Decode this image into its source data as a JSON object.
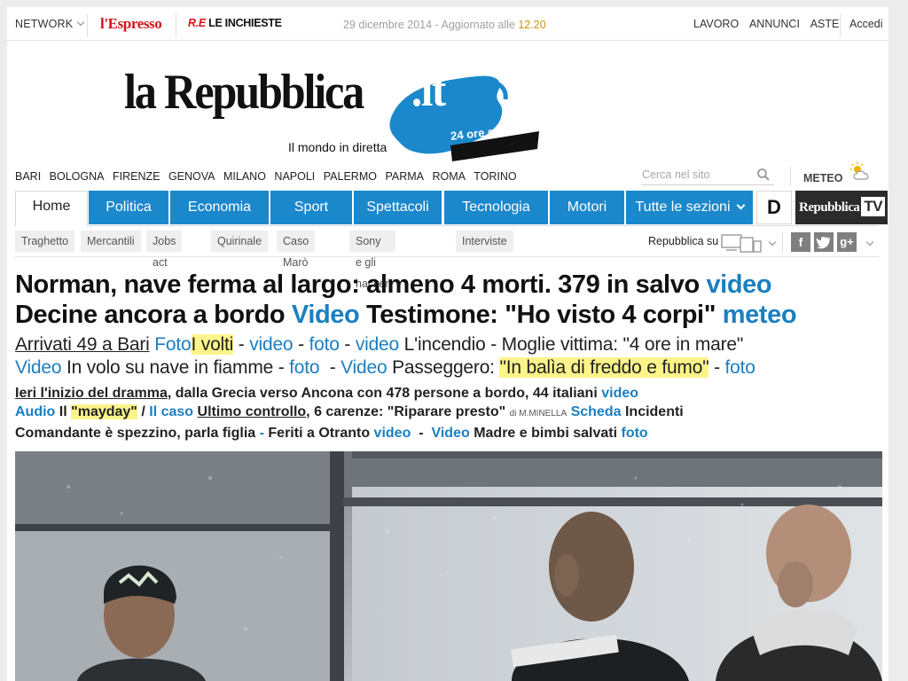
{
  "topbar": {
    "network": "NETWORK",
    "espresso": "l'Espresso",
    "inchieste_re": "R.E",
    "inchieste": "LE INCHIESTE",
    "date": "29 dicembre 2014 - Aggiornato alle ",
    "time": "12.20",
    "links": [
      "LAVORO",
      "ANNUNCI",
      "ASTE"
    ],
    "login": "Accedi"
  },
  "masthead": {
    "name": "la Repubblica",
    "tld": ".it",
    "tagline": "Il mondo in diretta",
    "badge": "24 ore su 24"
  },
  "cities": [
    "BARI",
    "BOLOGNA",
    "FIRENZE",
    "GENOVA",
    "MILANO",
    "NAPOLI",
    "PALERMO",
    "PARMA",
    "ROMA",
    "TORINO"
  ],
  "search": {
    "placeholder": "Cerca nel sito"
  },
  "meteo": "METEO",
  "nav": {
    "home": "Home",
    "sections": [
      "Politica",
      "Economia",
      "Sport",
      "Spettacoli",
      "Tecnologia",
      "Motori"
    ],
    "all": "Tutte le sezioni",
    "d": "D",
    "rtv": "Repubblica",
    "tv": "TV"
  },
  "tags": [
    "Traghetto",
    "Mercantili",
    "Jobs act",
    "Quirinale",
    "Caso Marò",
    "Sony e gli hacker",
    "Interviste"
  ],
  "social": {
    "label": "Repubblica su",
    "fb": "f",
    "gplus": "g+"
  },
  "headline": {
    "l1": "Norman, nave ferma al largo: almeno 4 morti. 379 in salvo",
    "l1_video": "video",
    "l2a": "Decine ancora a bordo",
    "l2_video": "Video",
    "l2b": "Testimone: \"Ho visto 4 corpi\"",
    "l2_meteo": "meteo"
  },
  "sub1": {
    "a": "Arrivati 49 a Bari",
    "foto": "Foto",
    "volti": "I volti",
    "d1": "-",
    "video1": "video",
    "d2": "-",
    "foto2": "foto",
    "d3": "-",
    "video2": "video",
    "b": "L'incendio - Moglie vittima: \"4 ore in mare\""
  },
  "sub2": {
    "video": "Video",
    "a": "In volo su nave in fiamme -",
    "foto": "foto",
    "d1": "-",
    "video2": "Video",
    "b": "Passeggero:",
    "quote": "\"In balìa di freddo e fumo\"",
    "d2": "-",
    "foto2": "foto"
  },
  "small1": {
    "a": "Ieri l'inizio del dramma",
    "b": ", dalla Grecia verso Ancona con 478 persone a bordo, 44 italiani",
    "video": "video"
  },
  "small2": {
    "audio": "Audio",
    "il": "Il",
    "mayday": "\"mayday\"",
    "slash": "/",
    "caso": "Il caso",
    "ultimo": "Ultimo controllo",
    "b": ", 6 carenze: \"Riparare presto\"",
    "by": "di M.MINELLA",
    "scheda": "Scheda",
    "inc": "Incidenti"
  },
  "small3": {
    "a": "Comandante è spezzino, parla figlia",
    "d1": "-",
    "b": "Feriti a Otranto",
    "video": "video",
    "d2": "-",
    "video2": "Video",
    "c": "Madre e bimbi salvati",
    "foto": "foto"
  },
  "colors": {
    "brand_blue": "#1b88cc",
    "link_blue": "#1b7fc1",
    "highlight": "#fbf48a",
    "espresso_red": "#d4141b"
  }
}
